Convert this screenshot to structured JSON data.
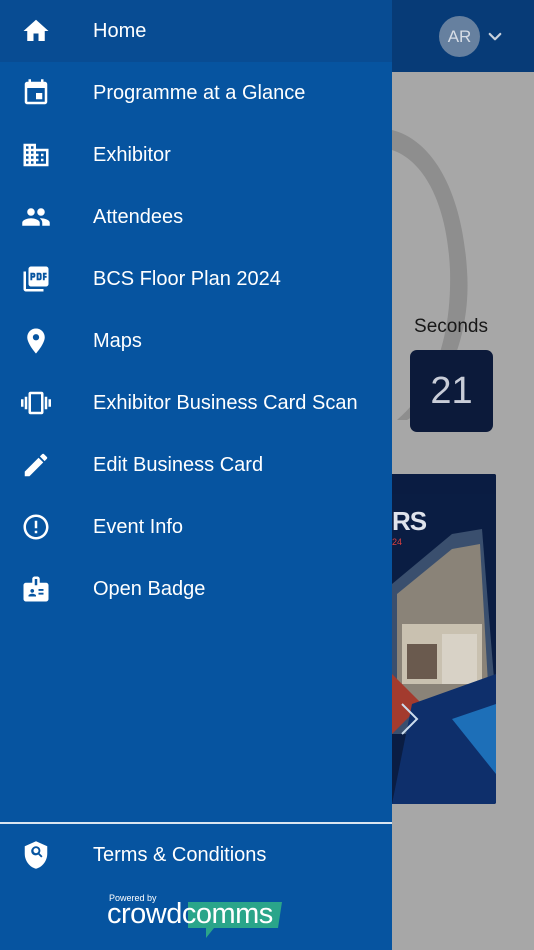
{
  "background": {
    "avatar_initials": "AR",
    "countdown_label": "Seconds",
    "countdown_value": "21",
    "poster_title_fragment": "RS",
    "poster_year_fragment": "24"
  },
  "menu": {
    "items": [
      {
        "label": "Home",
        "icon": "home-icon"
      },
      {
        "label": "Programme at a Glance",
        "icon": "calendar-icon"
      },
      {
        "label": "Exhibitor",
        "icon": "building-icon"
      },
      {
        "label": "Attendees",
        "icon": "people-icon"
      },
      {
        "label": "BCS Floor Plan 2024",
        "icon": "pdf-icon"
      },
      {
        "label": "Maps",
        "icon": "map-pin-icon"
      },
      {
        "label": "Exhibitor Business Card Scan",
        "icon": "phone-vibrate-icon"
      },
      {
        "label": "Edit Business Card",
        "icon": "pencil-icon"
      },
      {
        "label": "Event Info",
        "icon": "info-circle-icon"
      },
      {
        "label": "Open Badge",
        "icon": "badge-icon"
      }
    ],
    "terms_label": "Terms & Conditions"
  },
  "footer": {
    "powered_by": "Powered by",
    "brand_part1": "crowd",
    "brand_part2": "comms"
  },
  "colors": {
    "drawer": "#0654a0",
    "header": "#073b77",
    "brand_accent": "#2aa58a"
  }
}
